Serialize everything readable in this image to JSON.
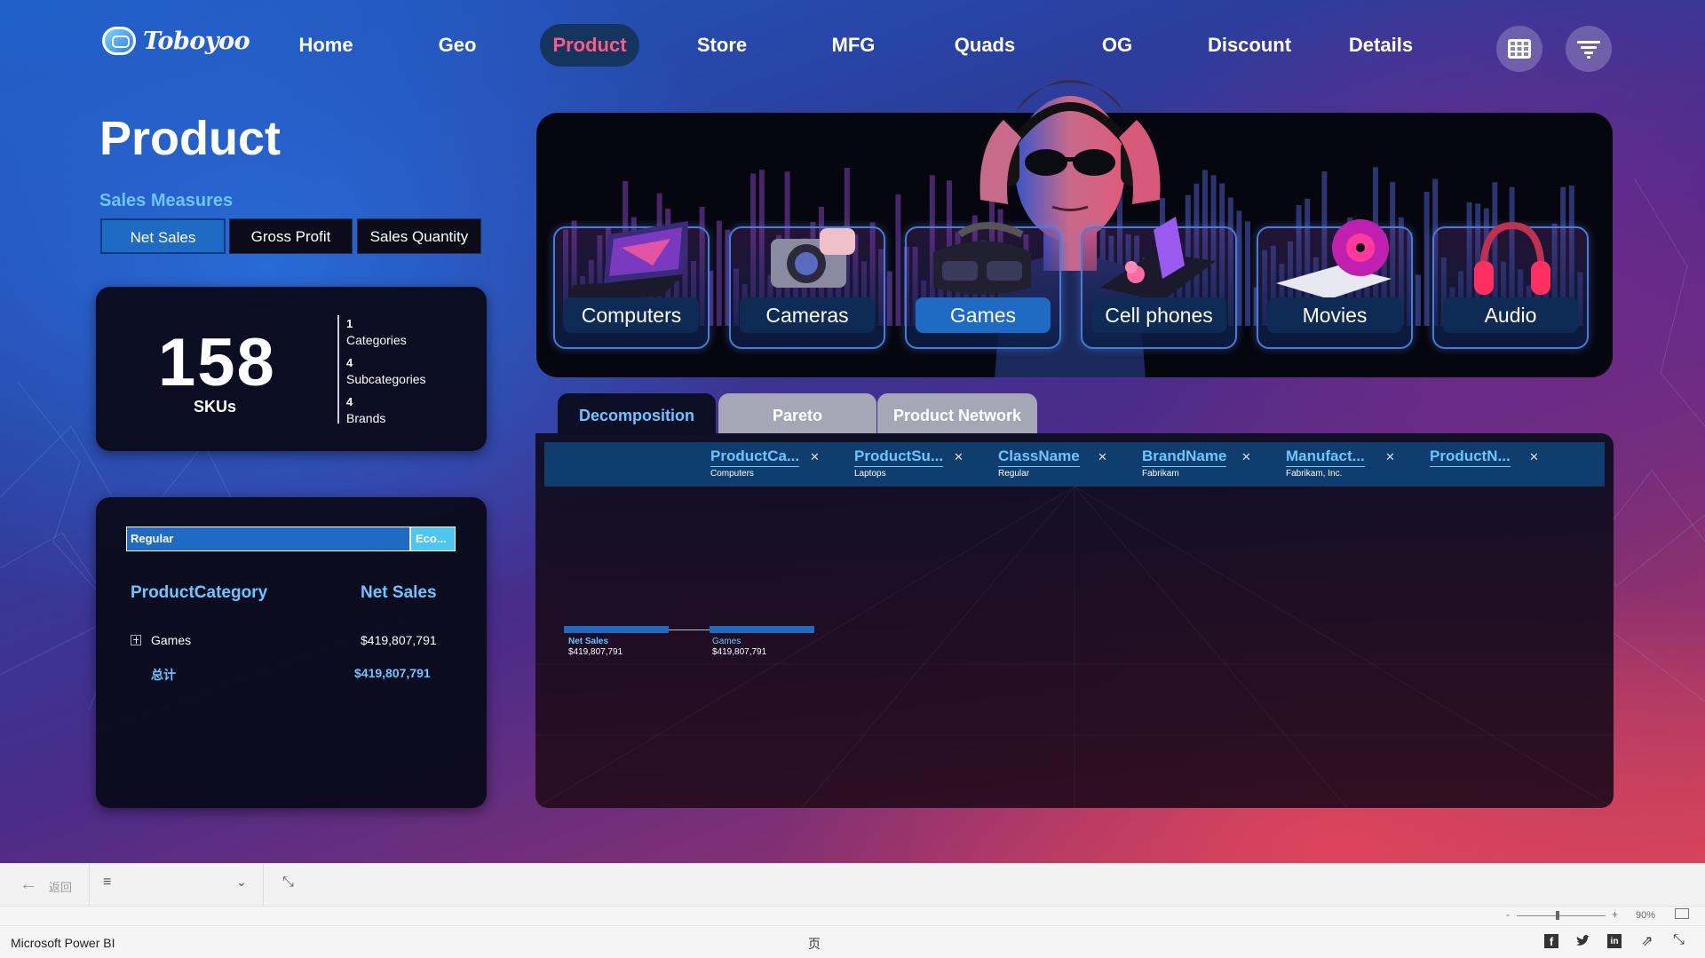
{
  "brand": {
    "name": "Toboyoo"
  },
  "nav": {
    "items": [
      "Home",
      "Geo",
      "Product",
      "Store",
      "MFG",
      "Quads",
      "OG",
      "Discount",
      "Details"
    ],
    "active": "Product",
    "grid_button_icon": "grid-icon",
    "filter_button_icon": "filter-icon"
  },
  "page": {
    "title": "Product"
  },
  "sales_measures": {
    "label": "Sales Measures",
    "options": [
      "Net Sales",
      "Gross Profit",
      "Sales Quantity"
    ],
    "selected": "Net Sales"
  },
  "kpi": {
    "value": "158",
    "unit": "SKUs",
    "stats": [
      {
        "value": "1",
        "label": "Categories"
      },
      {
        "value": "4",
        "label": "Subcategories"
      },
      {
        "value": "4",
        "label": "Brands"
      }
    ]
  },
  "class_slicer": {
    "first": "Regular",
    "second": "Eco..."
  },
  "category_table": {
    "headers": [
      "ProductCategory",
      "Net Sales"
    ],
    "rows": [
      {
        "category": "Games",
        "net_sales": "$419,807,791"
      }
    ],
    "total": {
      "label": "总计",
      "net_sales": "$419,807,791"
    }
  },
  "categories": [
    "Computers",
    "Cameras",
    "Games",
    "Cell phones",
    "Movies",
    "Audio"
  ],
  "selected_category": "Games",
  "tabs": [
    "Decomposition",
    "Pareto",
    "Product Network"
  ],
  "active_tab": "Decomposition",
  "decomposition": {
    "levels": [
      {
        "title": "ProductCa...",
        "value": "Computers"
      },
      {
        "title": "ProductSu...",
        "value": "Laptops"
      },
      {
        "title": "ClassName",
        "value": "Regular"
      },
      {
        "title": "BrandName",
        "value": "Fabrikam"
      },
      {
        "title": "Manufact...",
        "value": "Fabrikam, Inc."
      },
      {
        "title": "ProductN...",
        "value": ""
      }
    ],
    "nodes": [
      {
        "label": "Net Sales",
        "value": "$419,807,791"
      },
      {
        "label": "Games",
        "value": "$419,807,791"
      }
    ]
  },
  "bottom_bar": {
    "back_label": "返回",
    "zoom": "90%",
    "app_name": "Microsoft Power BI",
    "page_glyph": "页"
  },
  "colors": {
    "accent": "#1f6bc4",
    "highlight": "#6cc6ff",
    "active_nav_text": "#ff5a86"
  }
}
